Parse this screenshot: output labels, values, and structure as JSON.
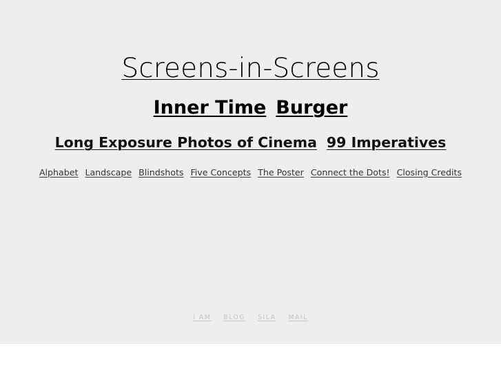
{
  "colors": {
    "page_background": "#eeeeee",
    "below_page_background": "#ffffff",
    "primary_text": "#000000",
    "secondary_text": "#333333",
    "footer_text": "#c3c3c3"
  },
  "site": {
    "title": "Screens-in-Screens"
  },
  "nav": {
    "row_primary": [
      {
        "label": "Screens-in-Screens"
      }
    ],
    "row_secondary": [
      {
        "label": "Inner Time"
      },
      {
        "label": "Burger"
      }
    ],
    "row_tertiary": [
      {
        "label": "Long Exposure Photos of Cinema"
      },
      {
        "label": "99 Imperatives"
      }
    ],
    "row_quaternary": [
      {
        "label": "Alphabet"
      },
      {
        "label": "Landscape"
      },
      {
        "label": "Blindshots"
      },
      {
        "label": "Five Concepts"
      },
      {
        "label": "The Poster"
      },
      {
        "label": "Connect the Dots!"
      },
      {
        "label": "Closing Credits"
      }
    ]
  },
  "footer": {
    "links": [
      {
        "label": "I AM"
      },
      {
        "label": "BLOG"
      },
      {
        "label": "SILA"
      },
      {
        "label": "MAIL"
      }
    ]
  }
}
